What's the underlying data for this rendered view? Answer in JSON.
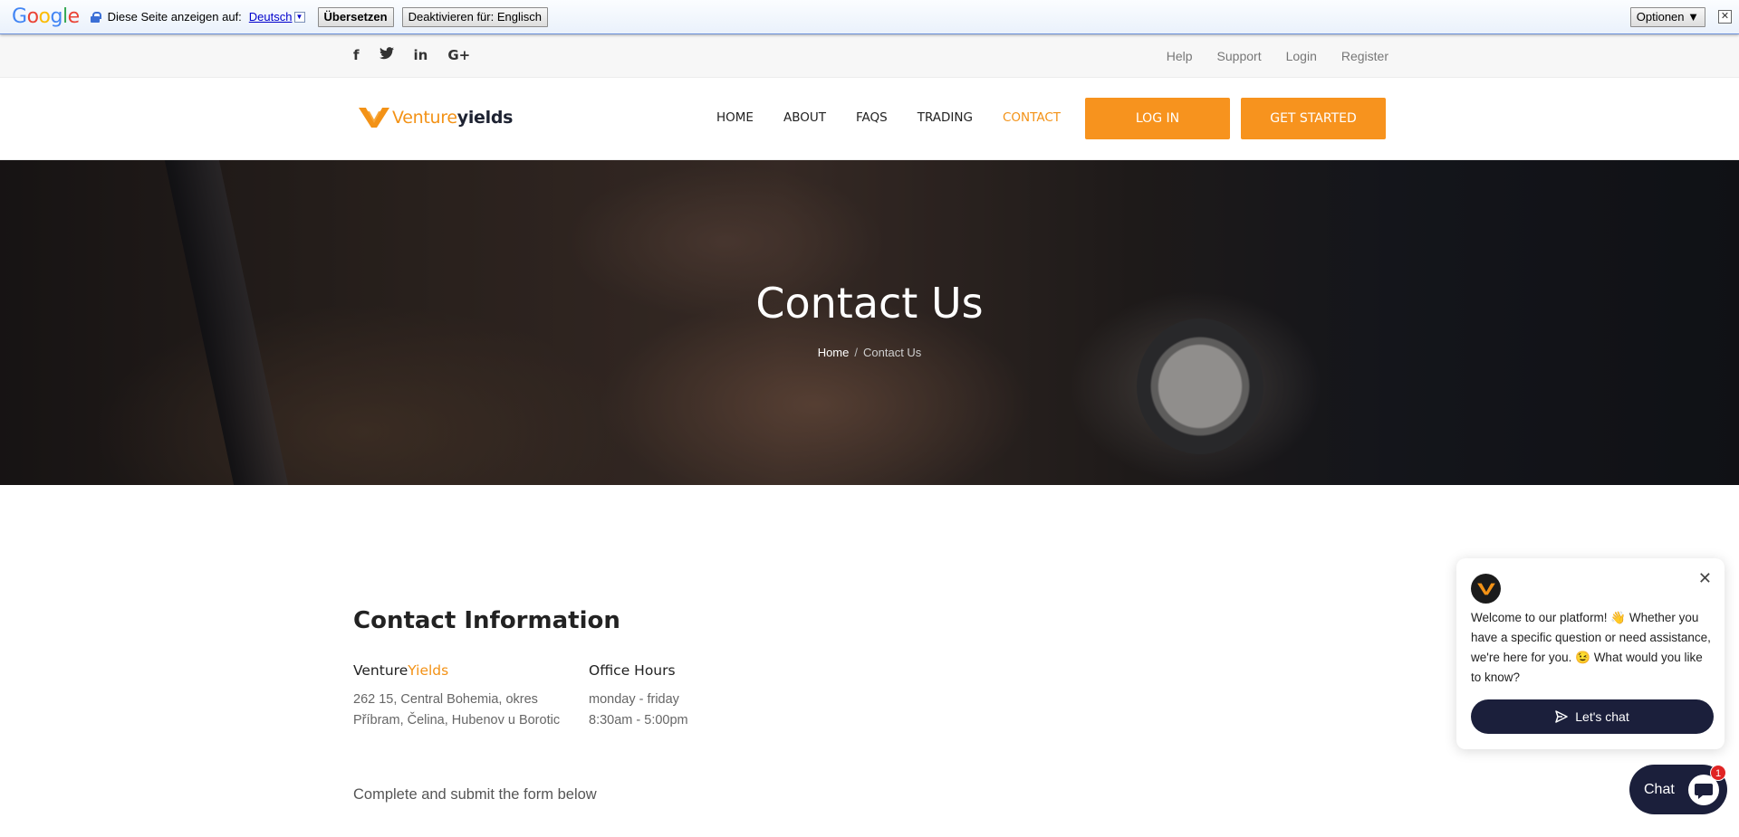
{
  "translate_bar": {
    "logo": "Google",
    "prompt": "Diese Seite anzeigen auf:",
    "language": "Deutsch",
    "translate_button": "Übersetzen",
    "disable_button": "Deaktivieren für: Englisch",
    "options_button": "Optionen ▼"
  },
  "topbar": {
    "social_icons": [
      "facebook-icon",
      "twitter-icon",
      "linkedin-icon",
      "google-plus-icon"
    ],
    "links": [
      "Help",
      "Support",
      "Login",
      "Register"
    ]
  },
  "brand": {
    "part1": "Venture",
    "part2": "yields",
    "accent_color": "#f39216"
  },
  "nav": {
    "items": [
      "HOME",
      "ABOUT",
      "FAQS",
      "TRADING",
      "CONTACT"
    ],
    "active": "CONTACT",
    "login_button": "LOG IN",
    "start_button": "GET STARTED"
  },
  "hero": {
    "title": "Contact Us",
    "breadcrumb_home": "Home",
    "breadcrumb_sep": "/",
    "breadcrumb_current": "Contact Us"
  },
  "contact": {
    "title": "Contact Information",
    "company_part1": "Venture",
    "company_part2": "Yields",
    "address_line1": "262 15, Central Bohemia, okres",
    "address_line2": "Příbram, Čelina, Hubenov u Borotic",
    "hours_title": "Office Hours",
    "hours_days": "monday - friday",
    "hours_time": "8:30am - 5:00pm",
    "form_note": "Complete and submit the form below"
  },
  "chat": {
    "message": "Welcome to our platform! 👋 Whether you have a specific question or need assistance, we're here for you. 😉 What would you like to know?",
    "cta": "Let's chat",
    "launcher_label": "Chat",
    "badge_count": "1",
    "button_color": "#1b1f3b"
  }
}
